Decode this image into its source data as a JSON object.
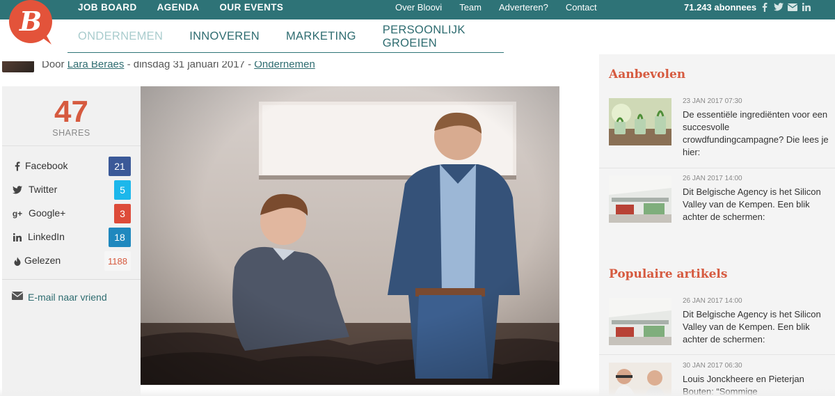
{
  "topnav": {
    "left": [
      "JOB BOARD",
      "AGENDA",
      "OUR EVENTS"
    ],
    "right": [
      "Over Bloovi",
      "Team",
      "Adverteren?",
      "Contact"
    ],
    "subscribers": "71.243 abonnees",
    "social_icons": [
      "facebook-icon",
      "twitter-icon",
      "email-icon",
      "linkedin-icon"
    ]
  },
  "logo": {
    "letter": "B",
    "color": "#e3533a"
  },
  "catnav": {
    "items": [
      "ONDERNEMEN",
      "INNOVEREN",
      "MARKETING",
      "PERSOONLIJK GROEIEN"
    ],
    "active": "ONDERNEMEN"
  },
  "byline": {
    "prefix": "Door",
    "author": "Lara Beraes",
    "date": "dinsdag 31 januari 2017",
    "category": "Ondernemen"
  },
  "shares": {
    "count": "47",
    "label": "SHARES",
    "rows": [
      {
        "label": "Facebook",
        "count": "21",
        "icon": "facebook-icon",
        "color": "#3b5998"
      },
      {
        "label": "Twitter",
        "count": "5",
        "icon": "twitter-icon",
        "color": "#1cb7eb"
      },
      {
        "label": "Google+",
        "count": "3",
        "icon": "google-plus-icon",
        "color": "#dd4b39"
      },
      {
        "label": "LinkedIn",
        "count": "18",
        "icon": "linkedin-icon",
        "color": "#1f88be"
      },
      {
        "label": "Gelezen",
        "count": "1188",
        "icon": "flame-icon",
        "color": "#d65a3f"
      }
    ],
    "email": "E-mail naar vriend"
  },
  "sidebar": {
    "recommended_title": "Aanbevolen",
    "recommended": [
      {
        "date": "23 JAN 2017 07:30",
        "title": "De essentiële ingrediënten voor een succesvolle crowdfundingcampagne? Die lees je hier:"
      },
      {
        "date": "26 JAN 2017 14:00",
        "title": "Dit Belgische Agency is het Silicon Valley van de Kempen. Een blik achter de schermen:"
      }
    ],
    "popular_title": "Populaire artikels",
    "popular": [
      {
        "date": "26 JAN 2017 14:00",
        "title": "Dit Belgische Agency is het Silicon Valley van de Kempen. Een blik achter de schermen:"
      },
      {
        "date": "30 JAN 2017 06:30",
        "title": "Louis Jonckheere en Pieterjan Bouten: “Sommige"
      }
    ]
  },
  "colors": {
    "teal": "#2e7377",
    "accent": "#d65a3f"
  }
}
